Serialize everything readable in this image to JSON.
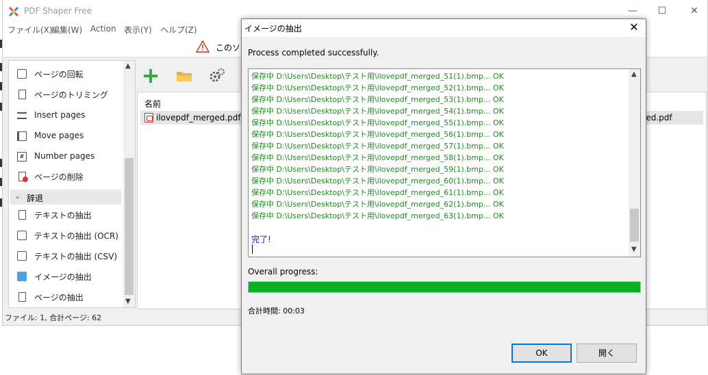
{
  "app": {
    "title": "PDF Shaper Free",
    "menu": [
      "ファイル(X)",
      "編集(W)",
      "Action",
      "表示(Y)",
      "ヘルプ(Z)"
    ],
    "notice_text": "このソフ",
    "status_bar": "ファイル: 1, 合計ページ: 62"
  },
  "sidebar": {
    "items": [
      {
        "label": "ページの回転",
        "icon": "rotate-page-icon"
      },
      {
        "label": "ページのトリミング",
        "icon": "crop-page-icon"
      },
      {
        "label": "Insert pages",
        "icon": "insert-pages-icon"
      },
      {
        "label": "Move pages",
        "icon": "move-pages-icon"
      },
      {
        "label": "Number pages",
        "icon": "number-pages-icon"
      },
      {
        "label": "ページの削除",
        "icon": "delete-page-icon"
      }
    ],
    "group": "辞退",
    "group_items": [
      {
        "label": "テキストの抽出",
        "icon": "extract-text-icon"
      },
      {
        "label": "テキストの抽出 (OCR)",
        "icon": "extract-text-ocr-icon"
      },
      {
        "label": "テキストの抽出 (CSV)",
        "icon": "extract-text-csv-icon"
      },
      {
        "label": "イメージの抽出",
        "icon": "extract-images-icon"
      },
      {
        "label": "ページの抽出",
        "icon": "extract-pages-icon"
      }
    ]
  },
  "filelist": {
    "column_name": "名前",
    "file_name": "ilovepdf_merged.pdf",
    "file_name_right": "rged.pdf"
  },
  "dialog": {
    "title": "イメージの抽出",
    "status": "Process completed successfully.",
    "log_lines": [
      "保存中 D:\\Users\\Desktop\\テスト用\\ilovepdf_merged_51(1).bmp... OK",
      "保存中 D:\\Users\\Desktop\\テスト用\\ilovepdf_merged_52(1).bmp... OK",
      "保存中 D:\\Users\\Desktop\\テスト用\\ilovepdf_merged_53(1).bmp... OK",
      "保存中 D:\\Users\\Desktop\\テスト用\\ilovepdf_merged_54(1).bmp... OK",
      "保存中 D:\\Users\\Desktop\\テスト用\\ilovepdf_merged_55(1).bmp... OK",
      "保存中 D:\\Users\\Desktop\\テスト用\\ilovepdf_merged_56(1).bmp... OK",
      "保存中 D:\\Users\\Desktop\\テスト用\\ilovepdf_merged_57(1).bmp... OK",
      "保存中 D:\\Users\\Desktop\\テスト用\\ilovepdf_merged_58(1).bmp... OK",
      "保存中 D:\\Users\\Desktop\\テスト用\\ilovepdf_merged_59(1).bmp... OK",
      "保存中 D:\\Users\\Desktop\\テスト用\\ilovepdf_merged_60(1).bmp... OK",
      "保存中 D:\\Users\\Desktop\\テスト用\\ilovepdf_merged_61(1).bmp... OK",
      "保存中 D:\\Users\\Desktop\\テスト用\\ilovepdf_merged_62(1).bmp... OK",
      "保存中 D:\\Users\\Desktop\\テスト用\\ilovepdf_merged_63(1).bmp... OK"
    ],
    "done_text": "完了!",
    "progress_label": "Overall progress:",
    "progress_value": 1.0,
    "elapsed": "合計時間: 00:03",
    "ok_label": "OK",
    "open_label": "開く"
  },
  "colors": {
    "log_green": "#1e8a1e",
    "done_blue": "#1a1aaa",
    "progress_green": "#06b025",
    "accent_blue": "#0078d7"
  }
}
